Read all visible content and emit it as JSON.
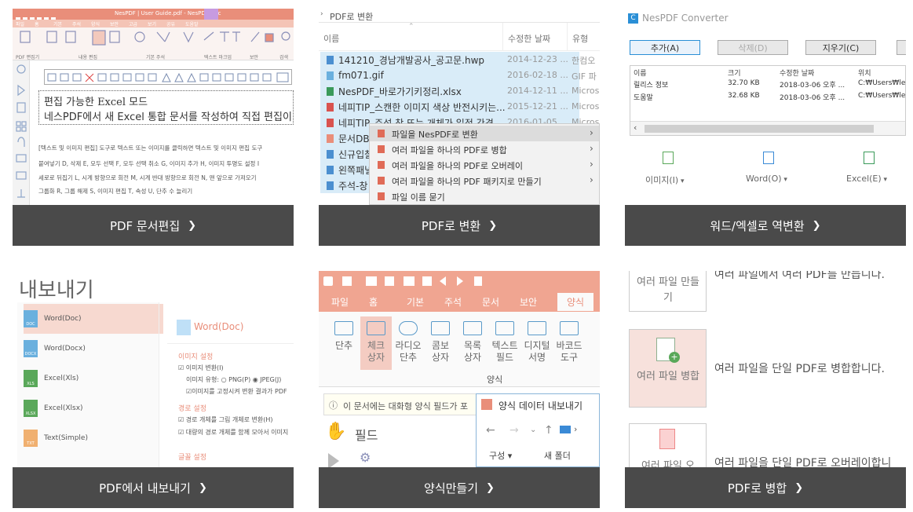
{
  "cards": [
    {
      "caption": "PDF 문서편집",
      "title_bar": "NesPDF | User Guide.pdf - NesPDF Doc",
      "ribbon_tabs": [
        "파일",
        "홈",
        "기본",
        "주석",
        "양식",
        "보안",
        "고급",
        "보기",
        "공유",
        "도움말"
      ],
      "ribbon_groups": [
        "PDF 편집기",
        "내용 편집",
        "기본 주석",
        "텍스트 마크업",
        "보안",
        "검색"
      ],
      "heading_line1": "편집 가능한 Excel 모드",
      "heading_line2": "네스PDF에서 새 Excel 통합 문서를 작성하여 직접 편집이 가",
      "body_lines": [
        "[텍스트 및 이미지 편집] 도구로 텍스트 또는 이미지를 클릭하면 텍스트 및 이미지 편집 도구",
        "붙여넣기 D, 삭제 E, 모두 선택 F, 모두 선택 취소 G, 이미지 추가 H, 이미지 투명도 설정 I",
        "세로로 뒤집기 L, 시계 방향으로 회전 M, 시계 반대 방향으로 회전 N, 맨 앞으로 가져오기",
        "그룹화 R, 그룹 해제 S, 이미지 편집 T, 속성 U, 단추 수 늘리기"
      ]
    },
    {
      "caption": "PDF로 변환",
      "breadcrumb": "PDF로 변환",
      "col_name": "이름",
      "col_date": "수정한 날짜",
      "col_type": "유형",
      "files": [
        {
          "name": "141210_경남개발공사_공고문.hwp",
          "date": "2014-12-23 ...",
          "type": "한컴오"
        },
        {
          "name": "fm071.gif",
          "date": "2016-02-18 ...",
          "type": "GIF 파"
        },
        {
          "name": "NesPDF_바로가기키정리.xlsx",
          "date": "2014-12-11 ...",
          "type": "Micros"
        },
        {
          "name": "네피TIP_스캔한 이미지 색상 반전시키는...",
          "date": "2015-12-21 ...",
          "type": "Micros"
        },
        {
          "name": "네피TIP_주석 창 또는 개체가 일정 간격...",
          "date": "2016-01-05 ...",
          "type": "Micros"
        },
        {
          "name": "문서DB",
          "date": "",
          "type": ""
        },
        {
          "name": "신규입찰",
          "date": "",
          "type": ""
        },
        {
          "name": "왼쪽패널",
          "date": "",
          "type": ""
        },
        {
          "name": "주석-창",
          "date": "",
          "type": ""
        }
      ],
      "context_menu": [
        "파일을 NesPDF로 변환",
        "여러 파일을 하나의 PDF로 병합",
        "여러 파일을 하나의 PDF로 오버레이",
        "여러 파일을 하나의 PDF 패키지로 만들기",
        "파일 이름 묻기"
      ]
    },
    {
      "caption": "워드/엑셀로 역변환",
      "app_title": "NesPDF Converter",
      "buttons": [
        "추가(A)",
        "삭제(D)",
        "지우기(C)"
      ],
      "columns": [
        "이름",
        "크기",
        "수정한 날짜",
        "위치"
      ],
      "rows": [
        [
          "릴리스 정보",
          "32.70 KB",
          "2018-03-06 오후 ...",
          "C:₩Users₩le"
        ],
        [
          "도움말",
          "32.68 KB",
          "2018-03-06 오후 ...",
          "C:₩Users₩le"
        ]
      ],
      "formats": [
        "이미지(I)",
        "Word(O)",
        "Excel(E)"
      ]
    },
    {
      "caption": "PDF에서 내보내기",
      "header": "내보내기",
      "formats": [
        {
          "label": "Word(Doc)",
          "tag": "DOC"
        },
        {
          "label": "Word(Docx)",
          "tag": "DOCX"
        },
        {
          "label": "Excel(Xls)",
          "tag": "XLS"
        },
        {
          "label": "Excel(Xlsx)",
          "tag": "XLSX"
        },
        {
          "label": "Text(Simple)",
          "tag": "TXT"
        }
      ],
      "detail_title": "Word(Doc)",
      "image_section": "이미지 설정",
      "image_convert": "이미지 변환(I)",
      "image_type_label": "이미지 유형:",
      "image_png": "PNG(P)",
      "image_jpeg": "JPEG(J)",
      "image_fixed": "이미지를 고정시켜 변환 결과가 PDF",
      "path_section": "경로 설정",
      "path_convert": "경로 개체를 그림 개체로 변환(H)",
      "path_merge": "대량의 경로 개체를 함께 모아서 이미지",
      "font_section": "글꼴 설정"
    },
    {
      "caption": "양식만들기",
      "tabs": [
        "파일",
        "홈",
        "기본",
        "주석",
        "문서",
        "보안",
        "양식"
      ],
      "tools": [
        "단추",
        "체크\n상자",
        "라디오\n단추",
        "콤보\n상자",
        "목록\n상자",
        "텍스트\n필드",
        "디지털\n서명",
        "바코드\n도구"
      ],
      "group_label": "양식",
      "info_bar": "이 문서에는 대화형 양식 필드가 포",
      "hand_label": "필드",
      "dialog_title": "양식 데이터 내보내기",
      "dialog_compose": "구성",
      "dialog_new_folder": "새 폴더"
    },
    {
      "caption": "PDF로 병합",
      "items": [
        {
          "tile": "여러 파일 만들기",
          "desc": "여러 파일에서 여러 PDF를 만듭니다."
        },
        {
          "tile": "여러 파일 병합",
          "desc": "여러 파일을 단일 PDF로 병합합니다."
        },
        {
          "tile": "여러 파일 오",
          "desc": "여러 파일을 단일 PDF로 오버레이합니"
        }
      ]
    }
  ],
  "colors": {
    "caption_bar": "#4a4a4a",
    "accent_orange": "#e98e7a",
    "selection_blue": "#d9ecf8"
  }
}
